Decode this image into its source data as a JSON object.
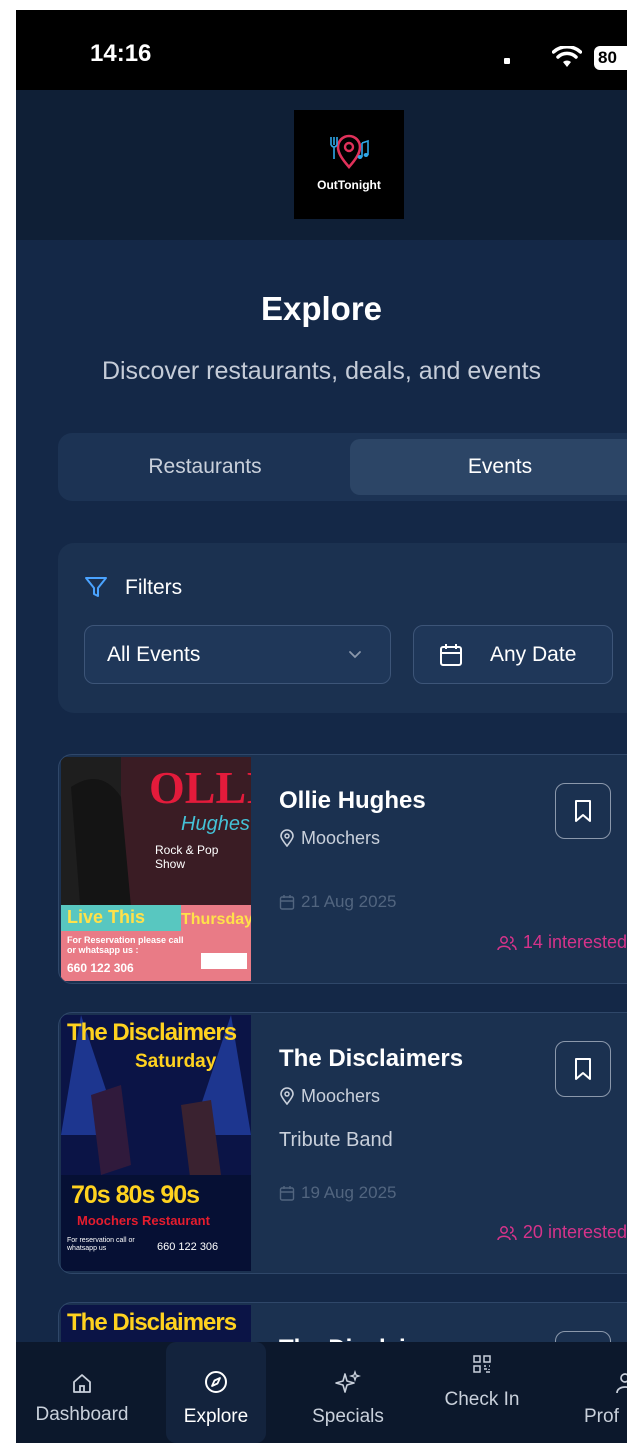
{
  "status_bar": {
    "time": "14:16",
    "battery": "80"
  },
  "header": {
    "logo_text": "OutTonight"
  },
  "page": {
    "title": "Explore",
    "subtitle": "Discover restaurants, deals, and events"
  },
  "tabs": [
    {
      "label": "Restaurants",
      "active": false
    },
    {
      "label": "Events",
      "active": true
    }
  ],
  "filters": {
    "label": "Filters",
    "category_selected": "All Events",
    "date_label": "Any Date"
  },
  "events": [
    {
      "title": "Ollie Hughes",
      "venue": "Moochers",
      "genre": "",
      "date": "21 Aug 2025",
      "interested": "14 interested",
      "poster": {
        "line1": "OLLIE",
        "line2": "Hughes",
        "line3": "Rock & Pop Show",
        "tag": "Live This",
        "day": "Thursday",
        "contact": "For Reservation please call or whatsapp us :",
        "phone": "660 122 306"
      }
    },
    {
      "title": "The Disclaimers",
      "venue": "Moochers",
      "genre": "Tribute Band",
      "date": "19 Aug 2025",
      "interested": "20 interested",
      "poster": {
        "line1": "The Disclaimers",
        "line2": "Saturday",
        "line3": "70s 80s 90s",
        "venue": "Moochers Restaurant",
        "contact": "For reservation call or whatsapp us",
        "phone": "660 122 306"
      }
    },
    {
      "title": "The Disclaimers",
      "poster": {
        "line1": "The Disclaimers"
      }
    }
  ],
  "tabbar": [
    {
      "label": "Dashboard",
      "icon": "home-icon"
    },
    {
      "label": "Explore",
      "icon": "compass-icon",
      "active": true
    },
    {
      "label": "Specials",
      "icon": "sparkles-icon"
    },
    {
      "label": "Check In",
      "icon": "qr-icon"
    },
    {
      "label": "Prof",
      "icon": "user-icon"
    }
  ],
  "colors": {
    "background": "#142847",
    "accent_pink": "#d6338a",
    "accent_blue": "#4aa3ff"
  }
}
